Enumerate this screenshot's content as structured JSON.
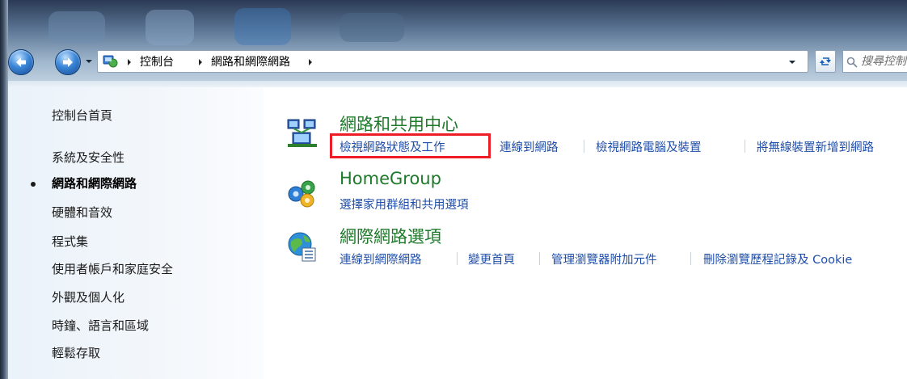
{
  "address_bar": {
    "breadcrumbs": [
      "控制台",
      "網路和網際網路"
    ],
    "location_icon": "control-panel-icon"
  },
  "search": {
    "placeholder": "搜尋控制台",
    "icon": "search-icon"
  },
  "left_pane": {
    "home_label": "控制台首頁",
    "categories": [
      {
        "label": "系統及安全性",
        "current": false
      },
      {
        "label": "網路和網際網路",
        "current": true
      },
      {
        "label": "硬體和音效",
        "current": false
      },
      {
        "label": "程式集",
        "current": false
      },
      {
        "label": "使用者帳戶和家庭安全",
        "current": false
      },
      {
        "label": "外觀及個人化",
        "current": false
      },
      {
        "label": "時鐘、語言和區域",
        "current": false
      },
      {
        "label": "輕鬆存取",
        "current": false
      }
    ]
  },
  "sections": [
    {
      "title": "網路和共用中心",
      "icon": "network-sharing-center-icon",
      "links": [
        "檢視網路狀態及工作",
        "連線到網路",
        "檢視網路電腦及裝置",
        "將無線裝置新增到網路"
      ]
    },
    {
      "title": "HomeGroup",
      "icon": "homegroup-icon",
      "links": [
        "選擇家用群組和共用選項"
      ]
    },
    {
      "title": "網際網路選項",
      "icon": "internet-options-icon",
      "links": [
        "連線到網際網路",
        "變更首頁",
        "管理瀏覽器附加元件",
        "刪除瀏覽歷程記錄及 Cookie"
      ]
    }
  ],
  "colors": {
    "section_title": "#1e7a2a",
    "link": "#1f4ea8",
    "highlight": "#ee1c24"
  }
}
